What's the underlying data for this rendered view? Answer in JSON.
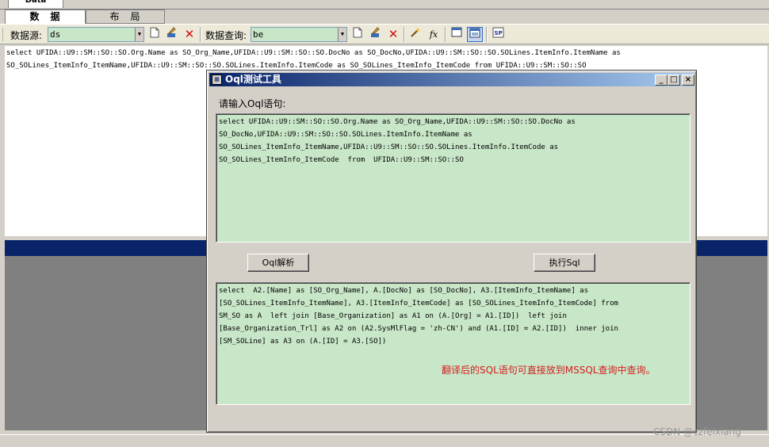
{
  "window": {
    "top_tab": "Data"
  },
  "page_tabs": [
    {
      "label": "数　据"
    },
    {
      "label": "布　局"
    }
  ],
  "toolbar": {
    "datasource_label": "数据源:",
    "datasource_value": "ds",
    "query_label": "数据查询:",
    "query_value": "be"
  },
  "main_editor": {
    "lines": [
      "select UFIDA::U9::SM::SO::SO.Org.Name as SO_Org_Name,UFIDA::U9::SM::SO::SO.DocNo as SO_DocNo,UFIDA::U9::SM::SO::SO.SOLines.ItemInfo.ItemName as",
      "SO_SOLines_ItemInfo_ItemName,UFIDA::U9::SM::SO::SO.SOLines.ItemInfo.ItemCode as SO_SOLines_ItemInfo_ItemCode  from  UFIDA::U9::SM::SO::SO"
    ]
  },
  "dialog": {
    "title": "Oql测试工具",
    "prompt": "请输入Oql语句:",
    "oql_input": "select UFIDA::U9::SM::SO::SO.Org.Name as SO_Org_Name,UFIDA::U9::SM::SO::SO.DocNo as\nSO_DocNo,UFIDA::U9::SM::SO::SO.SOLines.ItemInfo.ItemName as\nSO_SOLines_ItemInfo_ItemName,UFIDA::U9::SM::SO::SO.SOLines.ItemInfo.ItemCode as\nSO_SOLines_ItemInfo_ItemCode  from  UFIDA::U9::SM::SO::SO",
    "parse_button": "Oql解析",
    "execute_button": "执行Sql",
    "sql_output": "select  A2.[Name] as [SO_Org_Name], A.[DocNo] as [SO_DocNo], A3.[ItemInfo_ItemName] as\n[SO_SOLines_ItemInfo_ItemName], A3.[ItemInfo_ItemCode] as [SO_SOLines_ItemInfo_ItemCode] from\nSM_SO as A  left join [Base_Organization] as A1 on (A.[Org] = A1.[ID])  left join\n[Base_Organization_Trl] as A2 on (A2.SysMlFlag = 'zh-CN') and (A1.[ID] = A2.[ID])  inner join\n[SM_SOLine] as A3 on (A.[ID] = A3.[SO])",
    "note": "翻译后的SQL语句可直接放到MSSQL查询中查询。"
  },
  "watermark": "CSDN @czfeixiang",
  "colors": {
    "text_box_bg": "#c8e6c8",
    "title_gradient_start": "#0a246a",
    "title_gradient_end": "#a6caf0",
    "note_color": "#d42020"
  }
}
